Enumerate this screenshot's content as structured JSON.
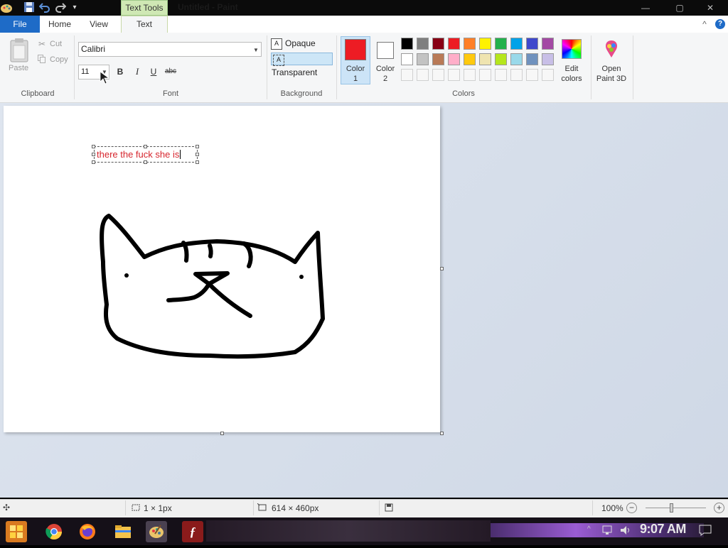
{
  "titlebar": {
    "context_tab": "Text Tools",
    "title": "Untitled - Paint",
    "qat_dropdown": "▾",
    "minimize": "—",
    "maximize": "▢",
    "close": "✕"
  },
  "tabs": {
    "file": "File",
    "home": "Home",
    "view": "View",
    "text": "Text"
  },
  "clipboard": {
    "paste": "Paste",
    "cut": "Cut",
    "copy": "Copy",
    "group": "Clipboard"
  },
  "font": {
    "family": "Calibri",
    "size": "11",
    "bold": "B",
    "italic": "I",
    "underline": "U",
    "strikethrough": "abc",
    "group": "Font"
  },
  "background": {
    "opaque": "Opaque",
    "transparent": "Transparent",
    "selected": "Transparent",
    "group": "Background"
  },
  "colors": {
    "color1_label_1": "Color",
    "color1_label_2": "1",
    "color2_label_1": "Color",
    "color2_label_2": "2",
    "color1_value": "#ed1c24",
    "color2_value": "#ffffff",
    "edit_colors_1": "Edit",
    "edit_colors_2": "colors",
    "group": "Colors",
    "palette_row1": [
      "#000000",
      "#7f7f7f",
      "#880015",
      "#ed1c24",
      "#ff7f27",
      "#fff200",
      "#22b14c",
      "#00a2e8",
      "#3f48cc",
      "#a349a4"
    ],
    "palette_row2": [
      "#ffffff",
      "#c3c3c3",
      "#b97a57",
      "#ffaec9",
      "#ffc90e",
      "#efe4b0",
      "#b5e61d",
      "#99d9ea",
      "#7092be",
      "#c8bfe7"
    ]
  },
  "paint3d": {
    "line1": "Open",
    "line2": "Paint 3D"
  },
  "canvas": {
    "text_content": "there the fuck she is"
  },
  "status": {
    "selection_size": "1 × 1px",
    "canvas_size": "614 × 460px",
    "zoom": "100%",
    "zoom_level": 1.0
  },
  "taskbar": {
    "clock": "9:07 AM"
  }
}
